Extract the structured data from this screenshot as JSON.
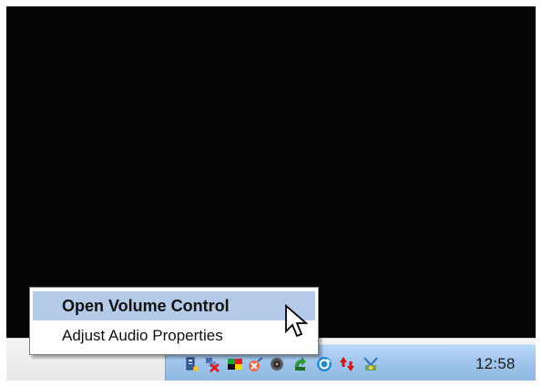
{
  "context_menu": {
    "items": [
      {
        "label": "Open Volume Control",
        "default": true
      },
      {
        "label": "Adjust Audio Properties",
        "default": false
      }
    ]
  },
  "taskbar": {
    "clock": "12:58",
    "tray_icons": [
      "server-icon",
      "network-disconnected-icon",
      "color-blocks-icon",
      "blocked-connection-icon",
      "speaker-icon",
      "recycle-arrow-icon",
      "refresh-globe-icon",
      "updown-arrows-icon",
      "network-wizard-icon"
    ]
  },
  "colors": {
    "desktop": "#050505",
    "tray_background": "#a1c6ec",
    "menu_highlight": "#b5c9e8"
  }
}
